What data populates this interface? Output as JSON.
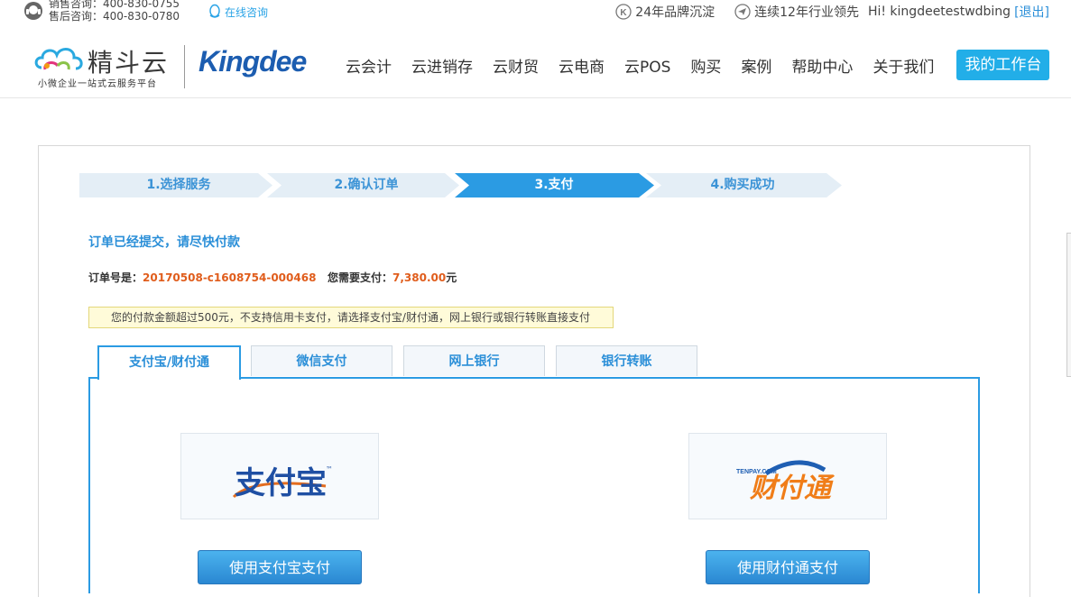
{
  "topbar": {
    "hotline_sales": "销售咨询：400-830-0755",
    "hotline_service": "售后咨询：400-830-0780",
    "online_consult": "在线咨询",
    "brand_years": "24年品牌沉淀",
    "industry_lead": "连续12年行业领先",
    "greeting": "Hi! kingdeetestwdbing",
    "logout": "[退出]"
  },
  "header": {
    "logo_cn": "精斗云",
    "logo_slogan": "小微企业一站式云服务平台",
    "logo_kingdee": "Kingdee",
    "nav": [
      "云会计",
      "云进销存",
      "云财贸",
      "云电商",
      "云POS",
      "购买",
      "案例",
      "帮助中心",
      "关于我们"
    ],
    "workbench": "我的工作台"
  },
  "steps": [
    {
      "label": "1.选择服务",
      "active": false
    },
    {
      "label": "2.确认订单",
      "active": false
    },
    {
      "label": "3.支付",
      "active": true
    },
    {
      "label": "4.购买成功",
      "active": false
    }
  ],
  "order": {
    "submitted_msg": "订单已经提交，请尽快付款",
    "order_no_label": "订单号是：",
    "order_no": "20170508-c1608754-000468",
    "amount_label": "您需要支付：",
    "amount": "7,380.00",
    "amount_unit": "元",
    "notice": "您的付款金额超过500元，不支持信用卡支付，请选择支付宝/财付通，网上银行或银行转账直接支付"
  },
  "tabs": [
    {
      "label": "支付宝/财付通",
      "active": true
    },
    {
      "label": "微信支付",
      "active": false
    },
    {
      "label": "网上银行",
      "active": false
    },
    {
      "label": "银行转账",
      "active": false
    }
  ],
  "payment": {
    "alipay_logo": "支付宝",
    "alipay_tm": "™",
    "alipay_button": "使用支付宝支付",
    "tenpay_logo": "财付通",
    "tenpay_domain": "TENPAY.COM",
    "tenpay_button": "使用财付通支付"
  },
  "colors": {
    "accent": "#2b8fd8",
    "step_active": "#2b9be3",
    "step_inactive": "#e4eef6",
    "order_number": "#e05d1c",
    "workbench": "#22aee8"
  }
}
